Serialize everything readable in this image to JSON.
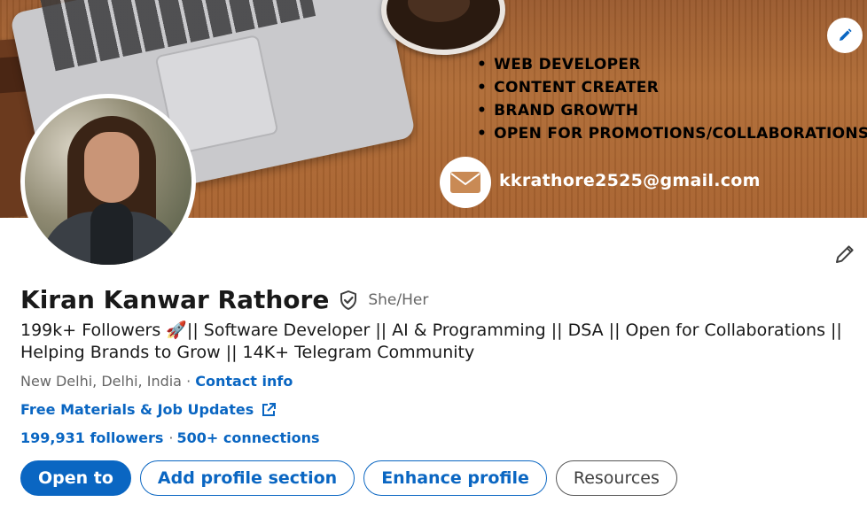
{
  "banner": {
    "bullets": [
      "WEB DEVELOPER",
      "CONTENT CREATER",
      "BRAND GROWTH",
      "OPEN FOR PROMOTIONS/COLLABORATIONS"
    ],
    "email": "kkrathore2525@gmail.com"
  },
  "profile": {
    "name": "Kiran Kanwar Rathore",
    "pronouns": "She/Her",
    "headline": "199k+ Followers 🚀|| Software Developer || AI & Programming || DSA || Open for Collaborations || Helping Brands to Grow || 14K+ Telegram Community",
    "location": "New Delhi, Delhi, India",
    "location_sep": " · ",
    "contact_info": "Contact info",
    "external_link": "Free Materials & Job Updates",
    "followers": "199,931 followers",
    "stats_sep": "·",
    "connections": "500+ connections"
  },
  "actions": {
    "open_to": "Open to",
    "add_section": "Add profile section",
    "enhance": "Enhance profile",
    "resources": "Resources"
  },
  "colors": {
    "accent": "#0a66c2",
    "muted_text": "#666666",
    "primary_text": "#191919"
  },
  "icons": {
    "banner_edit": "pencil-icon",
    "profile_edit": "pencil-icon",
    "verified": "shield-check-icon",
    "external_link": "external-link-icon",
    "email": "envelope-icon"
  }
}
